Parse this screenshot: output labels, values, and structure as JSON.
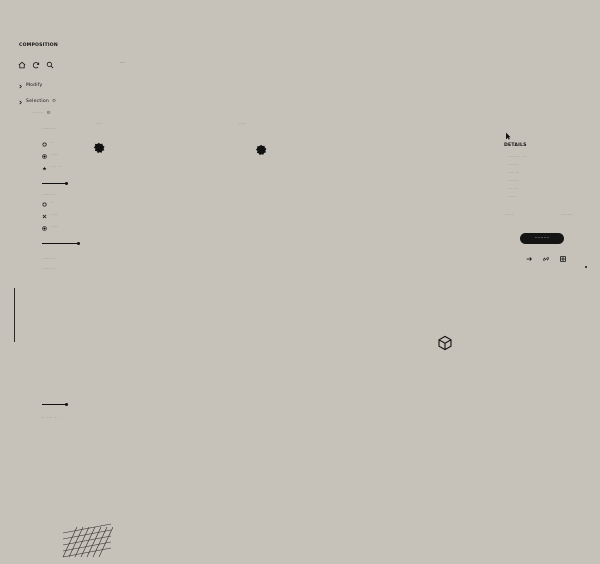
{
  "app": {
    "panel_title": "COMPOSITION",
    "top_mini": "⋯",
    "tree": {
      "item_0": {
        "label": "Modify"
      },
      "item_1": {
        "label": "Selection",
        "badge": "⚙"
      },
      "item_1_sub": {
        "label": "·······",
        "badge": "⚙"
      },
      "section_a_label": "·········",
      "section_a_opts": [
        "··",
        "····",
        "··· ··"
      ],
      "section_b_label": "·········",
      "section_b_opts": [
        "··",
        "····",
        "····"
      ],
      "section_c_label": "·········",
      "section_c_small": "·· ··· ·· ·",
      "section_d_label": "·········"
    }
  },
  "canvas": {
    "label_left": "····",
    "label_mid": "····"
  },
  "right_panel": {
    "title": "DETAILS",
    "list": [
      "······· ···",
      "······",
      "··· ··",
      "······",
      "·· ···",
      "····"
    ],
    "bottom_left": "·····",
    "bottom_right": "·······",
    "primary_button": "··········"
  },
  "icons": {
    "home": "home-icon",
    "refresh": "refresh-icon",
    "search": "search-icon",
    "caret": "chevron-right-icon",
    "gear": "gear-icon",
    "arrow": "cursor-icon",
    "cube": "cube-icon"
  }
}
